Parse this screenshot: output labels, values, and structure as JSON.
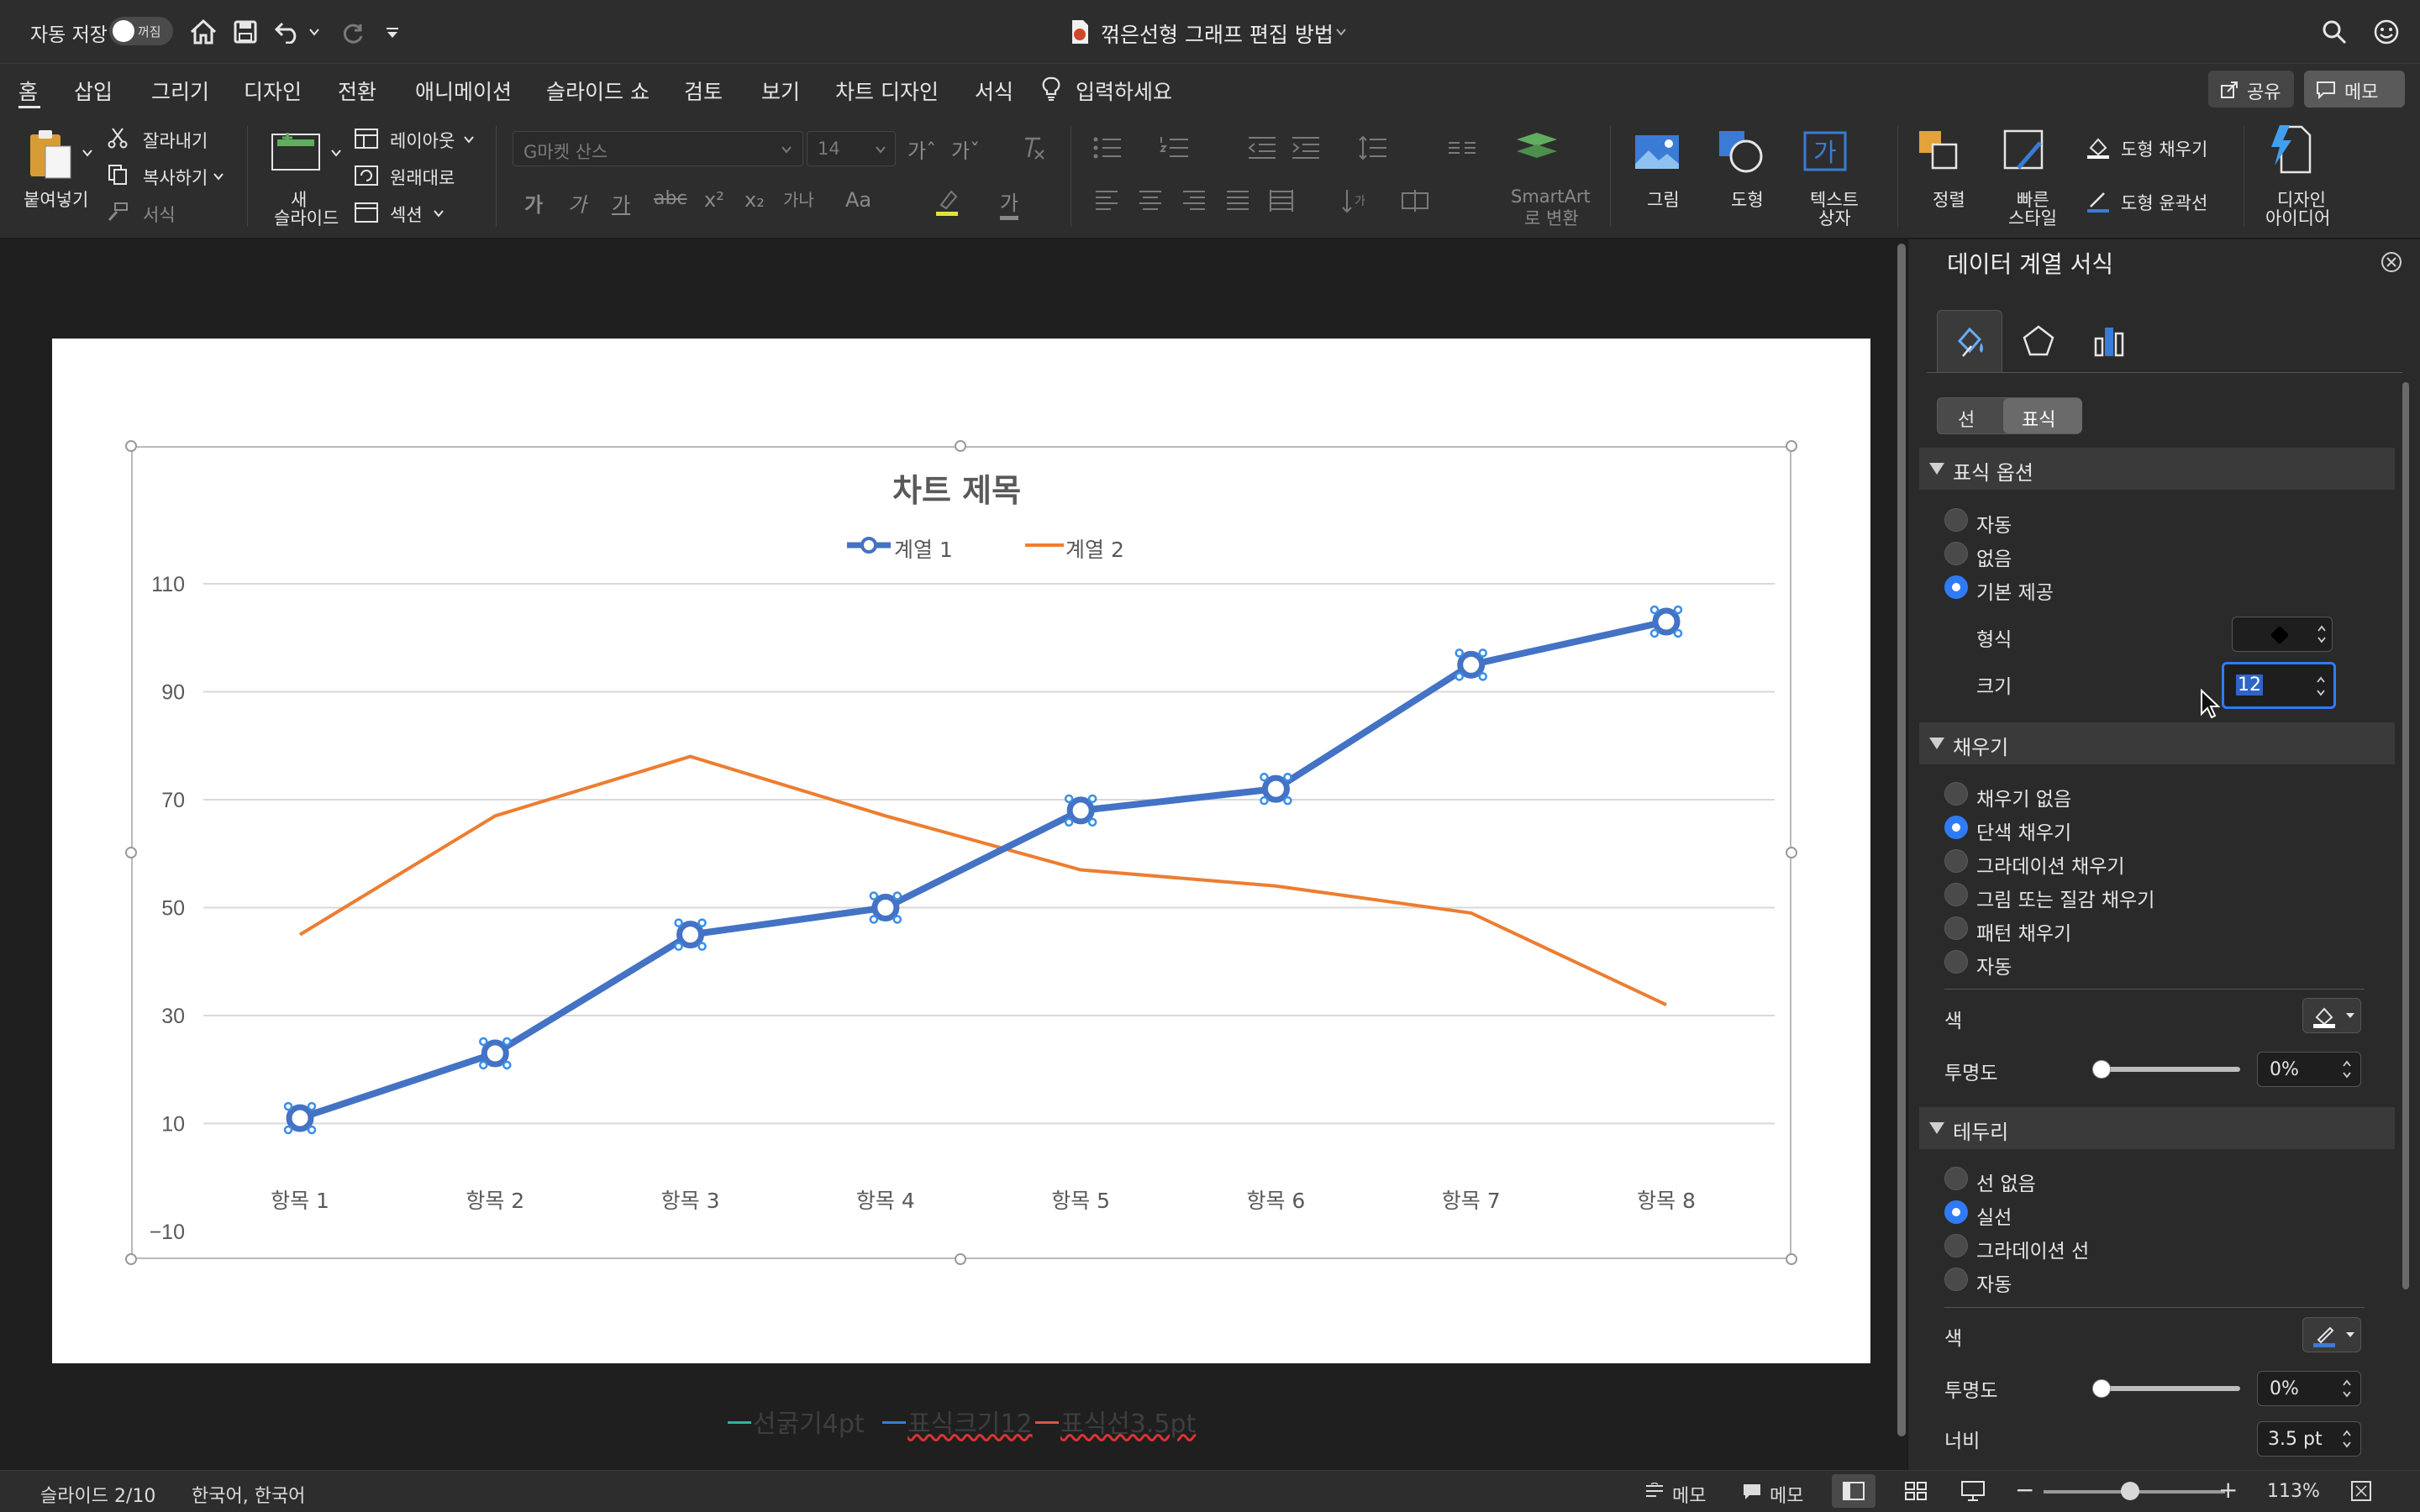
{
  "titlebar": {
    "autosave_label": "자동 저장",
    "autosave_state": "꺼짐",
    "doc_title": "꺾은선형 그래프 편집 방법"
  },
  "tabs": [
    "홈",
    "삽입",
    "그리기",
    "디자인",
    "전환",
    "애니메이션",
    "슬라이드 쇼",
    "검토",
    "보기",
    "차트 디자인",
    "서식"
  ],
  "tell_me": "입력하세요",
  "share_label": "공유",
  "memo_label": "메모",
  "ribbon": {
    "paste": "붙여넣기",
    "cut": "잘라내기",
    "copy": "복사하기",
    "format_painter": "서식",
    "new_slide_line1": "새",
    "new_slide_line2": "슬라이드",
    "layout": "레이아웃",
    "reset": "원래대로",
    "section": "섹션",
    "font_name": "G마켓 산스",
    "font_size": "14",
    "smartart_line1": "SmartArt",
    "smartart_line2": "로 변환",
    "picture": "그림",
    "shape": "도형",
    "textbox_line1": "텍스트",
    "textbox_line2": "상자",
    "arrange": "정렬",
    "quick_style_line1": "빠른",
    "quick_style_line2": "스타일",
    "shape_fill": "도형 채우기",
    "shape_outline": "도형 윤곽선",
    "designer_line1": "디자인",
    "designer_line2": "아이디어"
  },
  "chart_data": {
    "type": "line",
    "title": "차트 제목",
    "categories": [
      "항목 1",
      "항목 2",
      "항목 3",
      "항목 4",
      "항목 5",
      "항목 6",
      "항목 7",
      "항목 8"
    ],
    "series": [
      {
        "name": "계열 1",
        "color": "#4472c4",
        "values": [
          11,
          23,
          45,
          50,
          68,
          72,
          95,
          103
        ]
      },
      {
        "name": "계열 2",
        "color": "#ed7d31",
        "values": [
          45,
          67,
          78,
          67,
          57,
          54,
          49,
          32
        ]
      }
    ],
    "yticks": [
      110,
      90,
      70,
      50,
      30,
      10,
      -10
    ],
    "ylim": [
      -10,
      110
    ],
    "legend_position": "top"
  },
  "slide_note": {
    "seg1": "선굵기4pt",
    "seg2": "표식크기12",
    "seg3": "표식선3.5pt"
  },
  "panel": {
    "title": "데이터 계열 서식",
    "subtab_line": "선",
    "subtab_marker": "표식",
    "marker_options": {
      "header": "표식 옵션",
      "opt_auto": "자동",
      "opt_none": "없음",
      "opt_builtin": "기본 제공",
      "type_label": "형식",
      "size_label": "크기",
      "size_value": "12"
    },
    "fill": {
      "header": "채우기",
      "opts": [
        "채우기 없음",
        "단색 채우기",
        "그라데이션 채우기",
        "그림 또는 질감 채우기",
        "패턴 채우기",
        "자동"
      ],
      "color_label": "색",
      "transparency_label": "투명도",
      "transparency_value": "0%"
    },
    "border": {
      "header": "테두리",
      "opts": [
        "선 없음",
        "실선",
        "그라데이션 선",
        "자동"
      ],
      "color_label": "색",
      "transparency_label": "투명도",
      "transparency_value": "0%",
      "width_label": "너비",
      "width_value": "3.5 pt"
    }
  },
  "status": {
    "slide": "슬라이드 2/10",
    "language": "한국어, 한국어",
    "notes": "메모",
    "comments": "메모",
    "zoom": "113%"
  }
}
